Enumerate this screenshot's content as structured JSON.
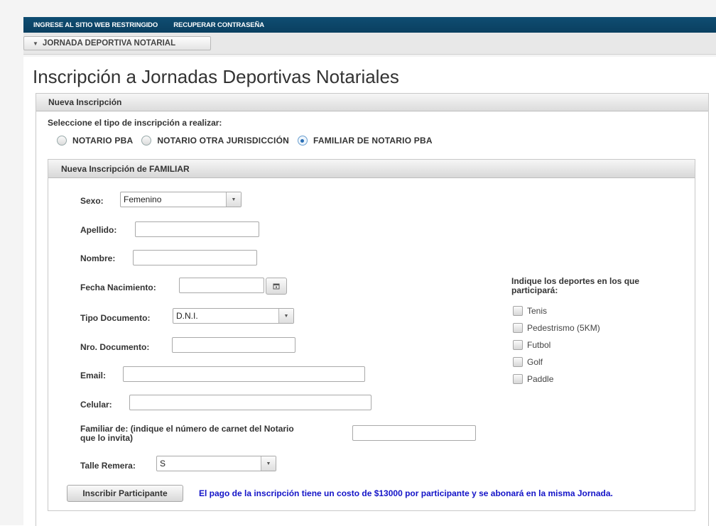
{
  "nav": {
    "links": [
      "INGRESE AL SITIO WEB RESTRINGIDO",
      "RECUPERAR CONTRASEÑA"
    ],
    "section_button": "JORNADA DEPORTIVA NOTARIAL"
  },
  "page_title": "Inscripción a Jornadas Deportivas Notariales",
  "panel": {
    "title": "Nueva Inscripción",
    "prompt": "Seleccione el tipo de inscripción a realizar:",
    "options": [
      {
        "label": "NOTARIO PBA",
        "checked": false
      },
      {
        "label": "NOTARIO OTRA JURISDICCIÓN",
        "checked": false
      },
      {
        "label": "FAMILIAR DE NOTARIO PBA",
        "checked": true
      }
    ]
  },
  "form": {
    "title": "Nueva Inscripción de FAMILIAR",
    "sexo_label": "Sexo:",
    "sexo_value": "Femenino",
    "apellido_label": "Apellido:",
    "apellido_value": "",
    "nombre_label": "Nombre:",
    "nombre_value": "",
    "fecha_label": "Fecha Nacimiento:",
    "fecha_value": "",
    "tipo_doc_label": "Tipo Documento:",
    "tipo_doc_value": "D.N.I.",
    "nro_doc_label": "Nro. Documento:",
    "nro_doc_value": "",
    "email_label": "Email:",
    "email_value": "",
    "celular_label": "Celular:",
    "celular_value": "",
    "familiar_label_1": "Familiar de: (indique el número de carnet del Notario",
    "familiar_label_2": "que lo invita)",
    "familiar_value": "",
    "talle_label": "Talle Remera:",
    "talle_value": "S",
    "sports_title_1": "Indique los deportes en los que",
    "sports_title_2": "participará:",
    "sports": [
      "Tenis",
      "Pedestrismo (5KM)",
      "Futbol",
      "Golf",
      "Paddle"
    ],
    "submit_label": "Inscribir Participante",
    "payment_note": "El pago de la inscripción tiene un costo de $13000 por participante y se abonará en la misma Jornada."
  }
}
